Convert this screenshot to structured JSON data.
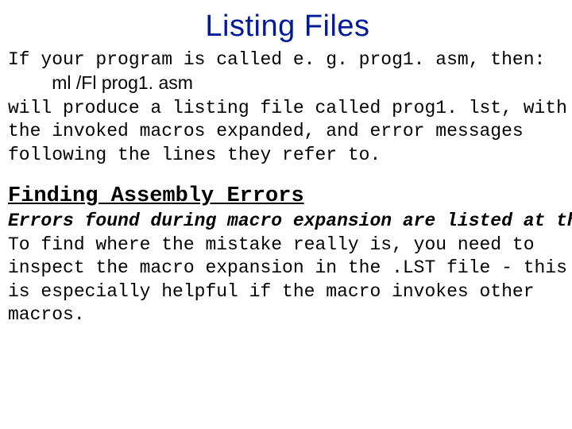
{
  "title": "Listing Files",
  "p1_a": "If your program is called e. g. prog1. asm, then:",
  "cmd": "ml /Fl prog1. asm",
  "p1_b": "will produce a listing file called prog1. lst, with the invoked macros expanded, and error messages following the lines they refer to.",
  "subhead": "Finding Assembly Errors",
  "p2_a": "Errors found during macro expansion are listed at the point of the macro invocation",
  "p2_b": "To find where the mistake really is, you need to inspect the macro expansion in the .LST file - this is especially helpful if the macro invokes other macros."
}
